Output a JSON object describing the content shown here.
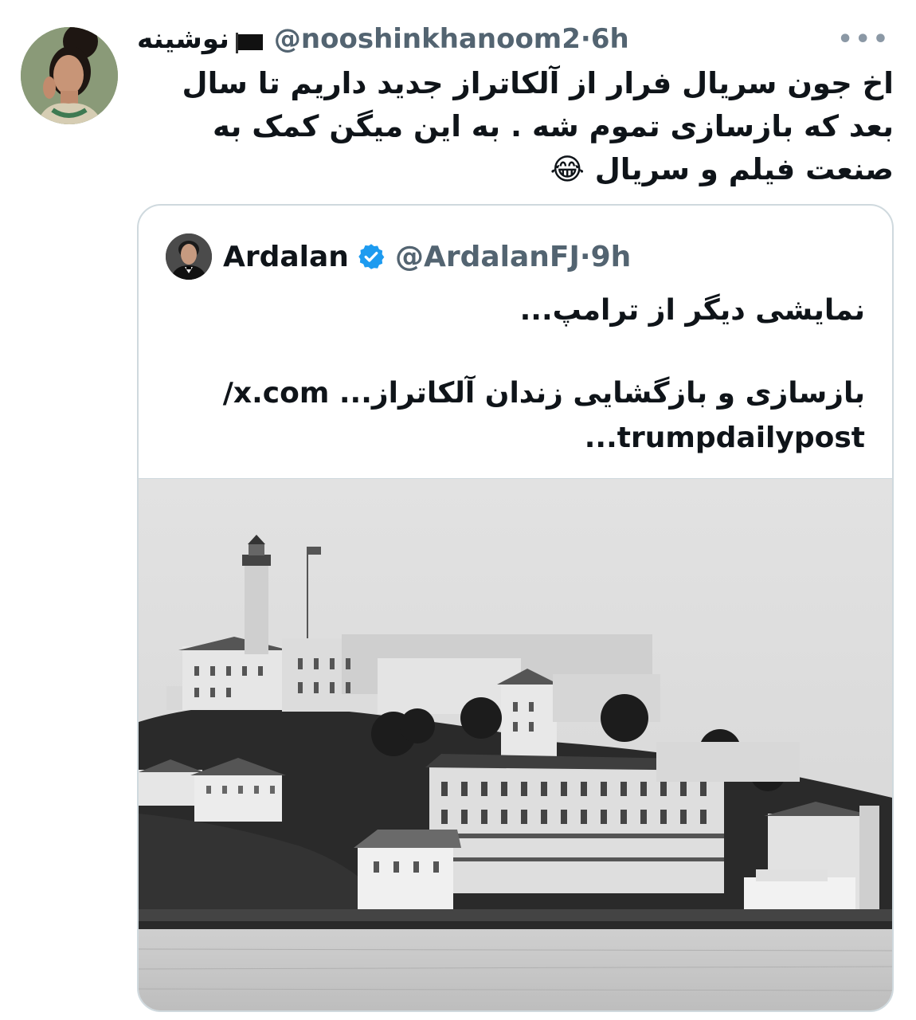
{
  "tweet": {
    "author_name": "نوشینه",
    "author_handle": "@nooshinkhanoom2",
    "time_sep": " · ",
    "time": "6h",
    "more_icon": "ellipsis-icon",
    "text": "اخ جون سریال فرار از آلکاتراز جدید داریم تا سال بعد که بازسازی تموم شه . به این میگن کمک به صنعت فیلم و سریال 😂"
  },
  "quote": {
    "author_name": "Ardalan",
    "author_handle": "@ArdalanFJ",
    "time_sep": " · ",
    "time": "9h",
    "verified_icon": "verified-badge-icon",
    "line1": "نمایشی دیگر از ترامپ...",
    "line2": "بازسازی و بازگشایی زندان آلکاتراز... x.com/",
    "line3": "trumpdailypost...",
    "image_alt": "historic black and white photo of Alcatraz island prison"
  },
  "colors": {
    "text": "#0f1419",
    "secondary": "#536471",
    "border": "#cfd9de",
    "verified": "#1d9bf0"
  }
}
